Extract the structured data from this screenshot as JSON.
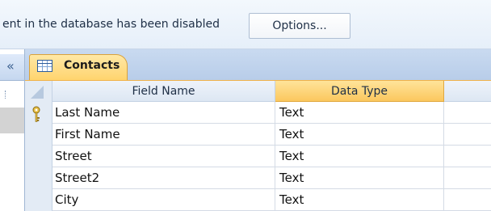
{
  "message_bar": {
    "text": "ent in the database has been disabled",
    "options_label": "Options..."
  },
  "nav_pane": {
    "collapse_glyph": "«",
    "collapse_icon": "chevrons-left-icon"
  },
  "document_tab": {
    "label": "Contacts",
    "icon": "table-icon"
  },
  "grid": {
    "headers": {
      "field_name": "Field Name",
      "data_type": "Data Type"
    },
    "primary_key_icon": "key-icon",
    "rows": [
      {
        "field_name": "Last Name",
        "data_type": "Text"
      },
      {
        "field_name": "First Name",
        "data_type": "Text"
      },
      {
        "field_name": "Street",
        "data_type": "Text"
      },
      {
        "field_name": "Street2",
        "data_type": "Text"
      },
      {
        "field_name": "City",
        "data_type": "Text"
      }
    ]
  },
  "colors": {
    "accent_tab": "#ffd46e",
    "header_active": "#fbc75e",
    "frame_blue": "#c9daf0"
  }
}
